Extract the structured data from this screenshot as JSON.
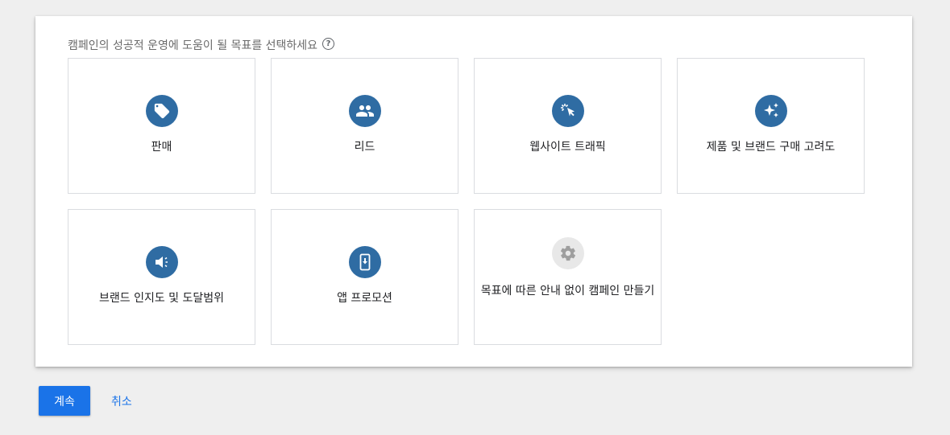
{
  "prompt": {
    "text": "캠페인의 성공적 운영에 도움이 될 목표를 선택하세요",
    "help": "?"
  },
  "goals": [
    {
      "label": "판매",
      "icon": "tag-icon"
    },
    {
      "label": "리드",
      "icon": "people-icon"
    },
    {
      "label": "웹사이트 트래픽",
      "icon": "cursor-click-icon"
    },
    {
      "label": "제품 및 브랜드 구매 고려도",
      "icon": "sparkle-icon"
    },
    {
      "label": "브랜드 인지도 및 도달범위",
      "icon": "speaker-icon"
    },
    {
      "label": "앱 프로모션",
      "icon": "phone-download-icon"
    },
    {
      "label": "목표에 따른 안내 없이 캠페인 만들기",
      "icon": "gear-icon"
    }
  ],
  "actions": {
    "continue": "계속",
    "cancel": "취소"
  },
  "colors": {
    "icon_bg": "#2f6ca3",
    "primary": "#1a73e8",
    "neutral_icon": "#9e9e9e"
  }
}
